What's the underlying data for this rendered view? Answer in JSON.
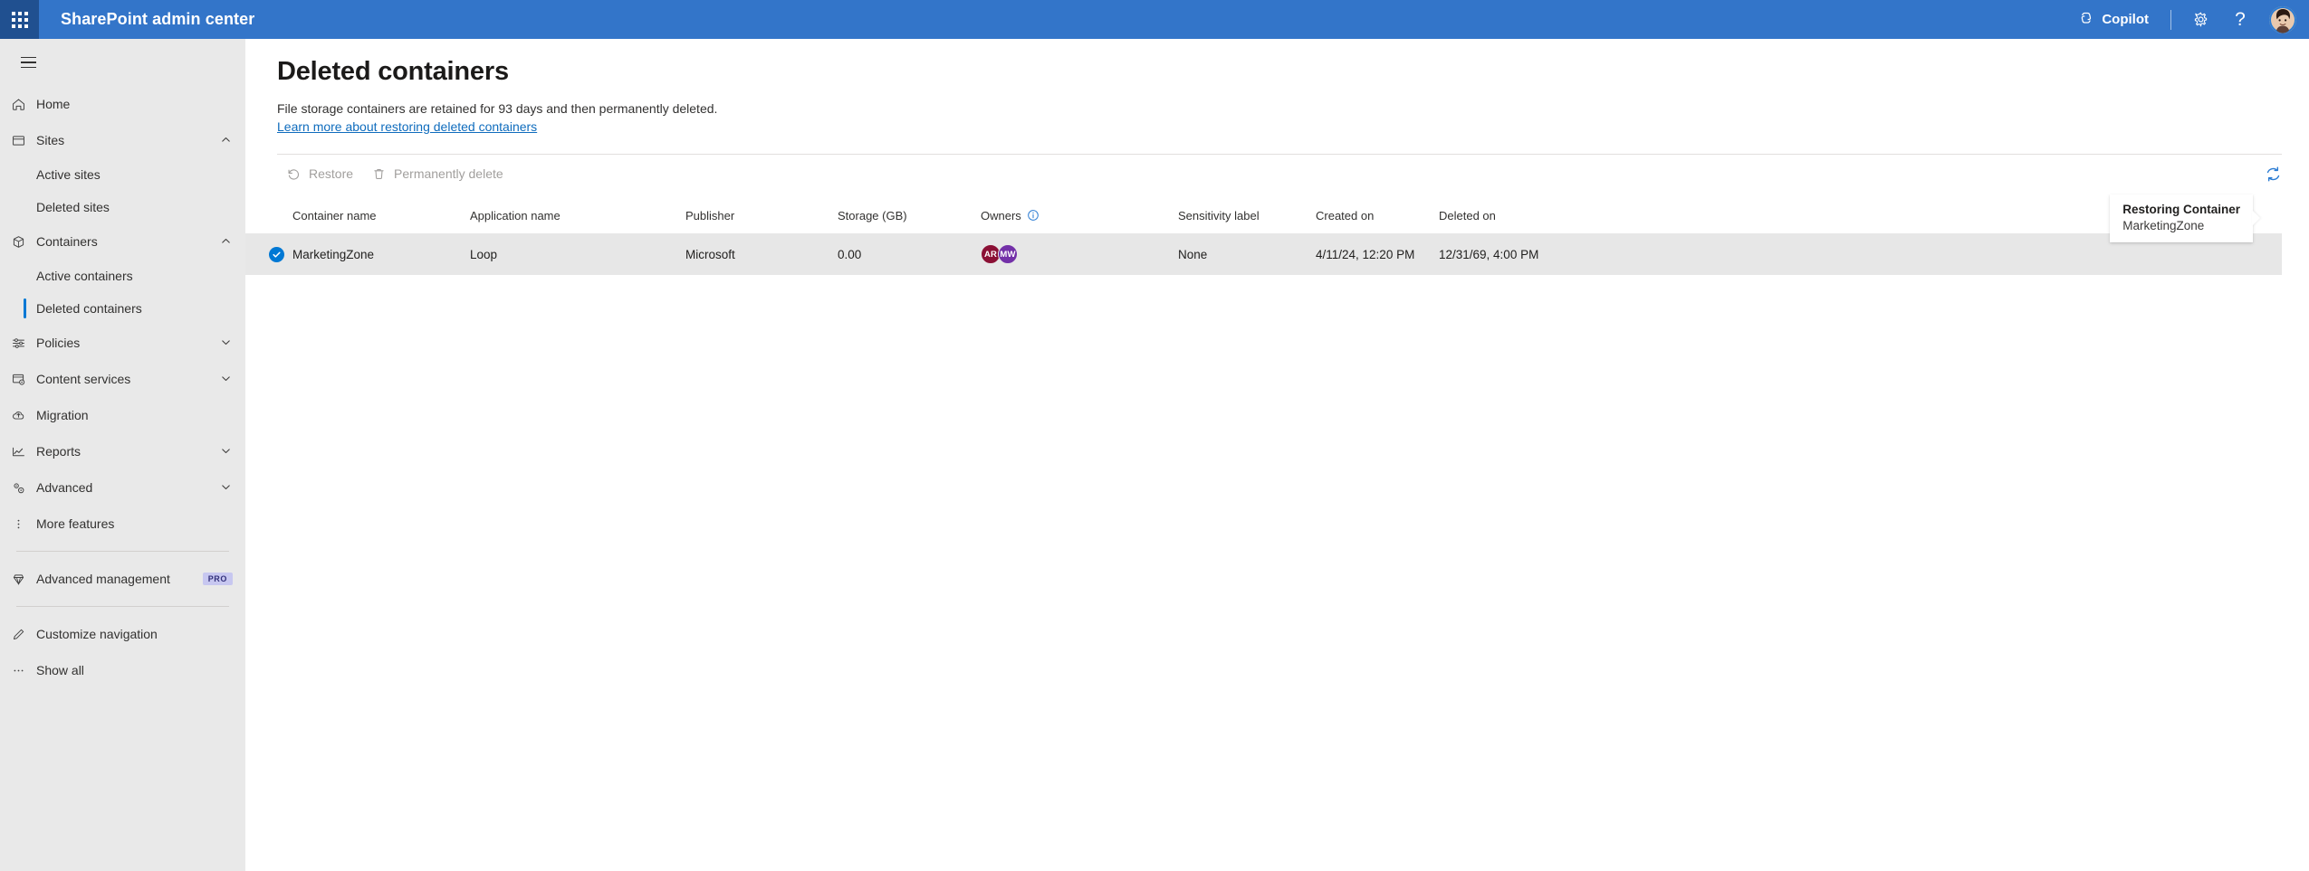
{
  "header": {
    "waffle_icon": "app-launcher-waffle-icon",
    "title": "SharePoint admin center",
    "copilot_label": "Copilot",
    "copilot_icon": "copilot-icon",
    "settings_icon": "gear-icon",
    "help_icon": "help-question-icon",
    "help_glyph": "?",
    "avatar_name": "user-avatar"
  },
  "sidebar": {
    "hamburger_icon": "hamburger-menu-icon",
    "items": [
      {
        "label": "Home",
        "icon": "home-icon",
        "type": "link"
      },
      {
        "label": "Sites",
        "icon": "sites-icon",
        "type": "group",
        "expanded": true,
        "chevron": "chevron-up-icon"
      },
      {
        "label": "Active sites",
        "type": "sub"
      },
      {
        "label": "Deleted sites",
        "type": "sub"
      },
      {
        "label": "Containers",
        "icon": "containers-box-icon",
        "type": "group",
        "expanded": true,
        "chevron": "chevron-up-icon"
      },
      {
        "label": "Active containers",
        "type": "sub"
      },
      {
        "label": "Deleted containers",
        "type": "sub",
        "selected": true
      },
      {
        "label": "Policies",
        "icon": "policies-sliders-icon",
        "type": "group",
        "expanded": false,
        "chevron": "chevron-down-icon"
      },
      {
        "label": "Content services",
        "icon": "content-services-icon",
        "type": "group",
        "expanded": false,
        "chevron": "chevron-down-icon"
      },
      {
        "label": "Migration",
        "icon": "migration-cloud-icon",
        "type": "link"
      },
      {
        "label": "Reports",
        "icon": "reports-chart-icon",
        "type": "group",
        "expanded": false,
        "chevron": "chevron-down-icon"
      },
      {
        "label": "Advanced",
        "icon": "advanced-gears-icon",
        "type": "group",
        "expanded": false,
        "chevron": "chevron-down-icon"
      },
      {
        "label": "More features",
        "icon": "more-features-dots-icon",
        "type": "link"
      }
    ],
    "advanced_management": {
      "label": "Advanced management",
      "icon": "diamond-icon",
      "badge": "PRO"
    },
    "customize_navigation": {
      "label": "Customize navigation",
      "icon": "pencil-edit-icon"
    },
    "show_all": {
      "label": "Show all",
      "icon": "ellipsis-icon"
    }
  },
  "page": {
    "title": "Deleted containers",
    "description": "File storage containers are retained for 93 days and then permanently deleted.",
    "link_text": "Learn more about restoring deleted containers"
  },
  "commandbar": {
    "restore": {
      "label": "Restore",
      "icon": "restore-undo-icon",
      "disabled": true
    },
    "permanently_delete": {
      "label": "Permanently delete",
      "icon": "trash-delete-icon",
      "disabled": true
    },
    "refresh": {
      "icon": "refresh-sync-icon",
      "color": "#2b7cd3"
    }
  },
  "callout": {
    "title": "Restoring Container",
    "subtitle": "MarketingZone"
  },
  "table": {
    "columns": [
      {
        "key": "name",
        "label": "Container name"
      },
      {
        "key": "app",
        "label": "Application name"
      },
      {
        "key": "publisher",
        "label": "Publisher"
      },
      {
        "key": "storage",
        "label": "Storage (GB)"
      },
      {
        "key": "owners",
        "label": "Owners",
        "info_icon": "info-circle-icon"
      },
      {
        "key": "sensitivity",
        "label": "Sensitivity label"
      },
      {
        "key": "created",
        "label": "Created on"
      },
      {
        "key": "deleted",
        "label": "Deleted on"
      }
    ],
    "rows": [
      {
        "selected": true,
        "name": "MarketingZone",
        "app": "Loop",
        "publisher": "Microsoft",
        "storage": "0.00",
        "owners": [
          {
            "initials": "AR",
            "color": "#8b1035"
          },
          {
            "initials": "MW",
            "color": "#7330a8"
          }
        ],
        "sensitivity": "None",
        "created": "4/11/24, 12:20 PM",
        "deleted": "12/31/69, 4:00 PM"
      }
    ]
  },
  "colors": {
    "header_blue": "#3375c9",
    "waffle_blue": "#205090",
    "accent": "#0078d4",
    "link": "#0f6cbd",
    "sidebar_bg": "#e9e9e9",
    "row_selected_bg": "#e7e7e7"
  }
}
